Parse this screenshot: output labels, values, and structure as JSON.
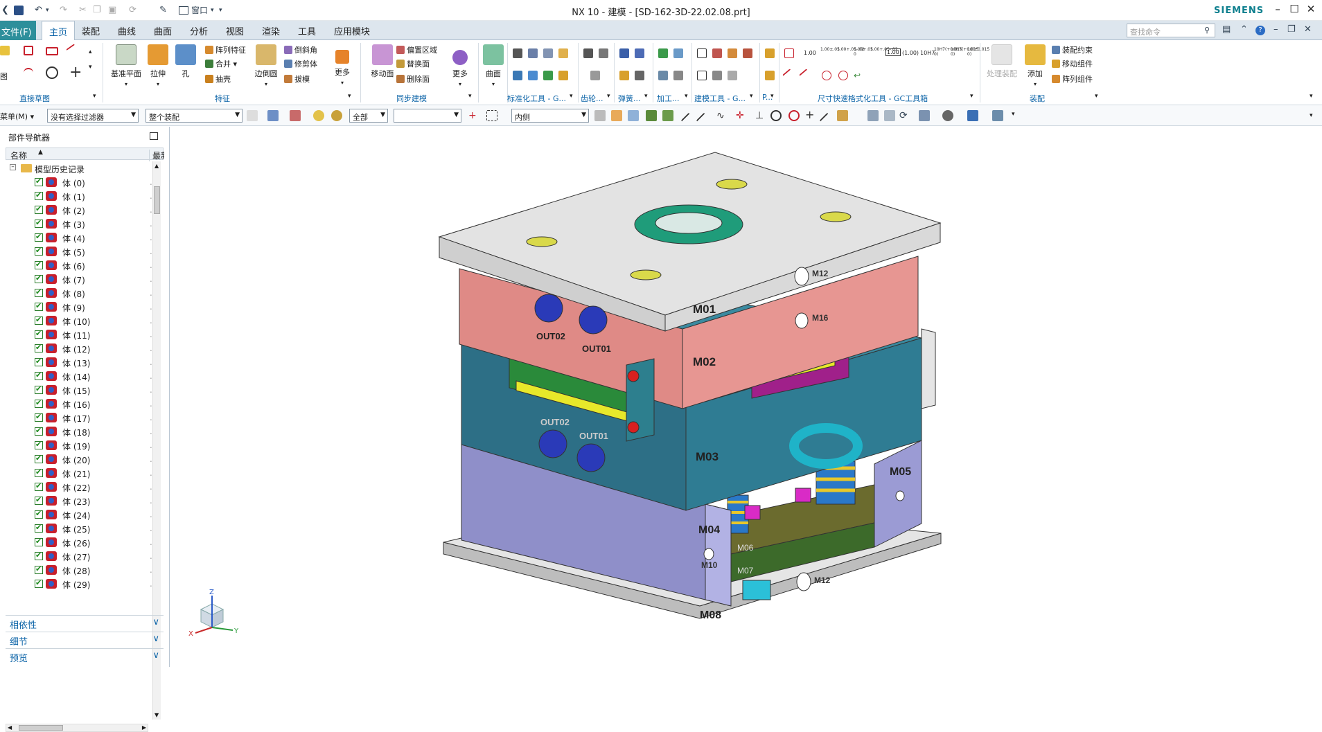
{
  "window": {
    "title": "NX 10 - 建模 - [SD-162-3D-22.02.08.prt]",
    "brand": "SIEMENS",
    "quick_window_label": "窗口"
  },
  "tabs": {
    "file": "文件(F)",
    "items": [
      "主页",
      "装配",
      "曲线",
      "曲面",
      "分析",
      "视图",
      "渲染",
      "工具",
      "应用模块"
    ],
    "active": "主页",
    "search_placeholder": "查找命令"
  },
  "ribbon": {
    "groups": {
      "sketch": "直接草图",
      "feature": "特征",
      "sync": "同步建模",
      "std": "标准化工具 - G...",
      "gear": "齿轮...",
      "spring": "弹簧...",
      "machining": "加工...",
      "modeling": "建模工具 - G...",
      "p": "P...",
      "dim": "尺寸快速格式化工具 - GC工具箱",
      "assembly": "装配"
    },
    "buttons": {
      "datum_plane": "基准平面",
      "extrude": "拉伸",
      "hole": "孔",
      "edge_blend": "边倒圆",
      "more1": "更多",
      "move_face": "移动面",
      "more2": "更多",
      "surface": "曲面",
      "handle_assembly": "处理装配",
      "add": "添加"
    },
    "small_buttons": {
      "pattern_feature": "阵列特征",
      "unite": "合并",
      "shell": "抽壳",
      "chamfer": "倒斜角",
      "trim_body": "修剪体",
      "draft": "拔模",
      "offset_region": "偏置区域",
      "replace_face": "替换面",
      "delete_face": "删除面",
      "assembly_constraints": "装配约束",
      "move_component": "移动组件",
      "pattern_component": "阵列组件"
    },
    "dim_labels": [
      "1.00",
      "1.00±.05",
      "1.00+.05-.02",
      "1.00+.05 0",
      "1.00+.05-.02",
      "1.00",
      "(1.00)",
      "10H7",
      "10H7(+0.015 0)",
      "10H7(+0.015 0)",
      "10(+0.015 0)"
    ]
  },
  "toolbar2": {
    "menu_label": "菜单(M)",
    "filter": "没有选择过滤器",
    "scope": "整个装配",
    "all": "全部",
    "empty": "",
    "inner": "内侧"
  },
  "navigator": {
    "title": "部件导航器",
    "col_name": "名称",
    "col_latest": "最新",
    "root": "模型历史记录",
    "bodies": [
      "体 (0)",
      "体 (1)",
      "体 (2)",
      "体 (3)",
      "体 (4)",
      "体 (5)",
      "体 (6)",
      "体 (7)",
      "体 (8)",
      "体 (9)",
      "体 (10)",
      "体 (11)",
      "体 (12)",
      "体 (13)",
      "体 (14)",
      "体 (15)",
      "体 (16)",
      "体 (17)",
      "体 (18)",
      "体 (19)",
      "体 (20)",
      "体 (21)",
      "体 (22)",
      "体 (23)",
      "体 (24)",
      "体 (25)",
      "体 (26)",
      "体 (27)",
      "体 (28)",
      "体 (29)"
    ],
    "sections": [
      "相依性",
      "细节",
      "预览"
    ]
  },
  "model": {
    "plates": [
      "M01",
      "M02",
      "M03",
      "M04",
      "M05",
      "M06",
      "M07",
      "M08"
    ],
    "holes": [
      "M12",
      "M16",
      "M10",
      "M12"
    ],
    "ports": [
      "OUT02",
      "OUT01",
      "OUT02",
      "OUT01"
    ],
    "axes": {
      "x": "X",
      "y": "Y",
      "z": "Z"
    }
  },
  "colors": {
    "accent": "#2e8f9b",
    "plate_top": "#e3e3e3",
    "plate_red": "#df8a86",
    "plate_teal": "#2d6f86",
    "plate_purple": "#8f8fc9",
    "brand": "#0d7f8e"
  }
}
